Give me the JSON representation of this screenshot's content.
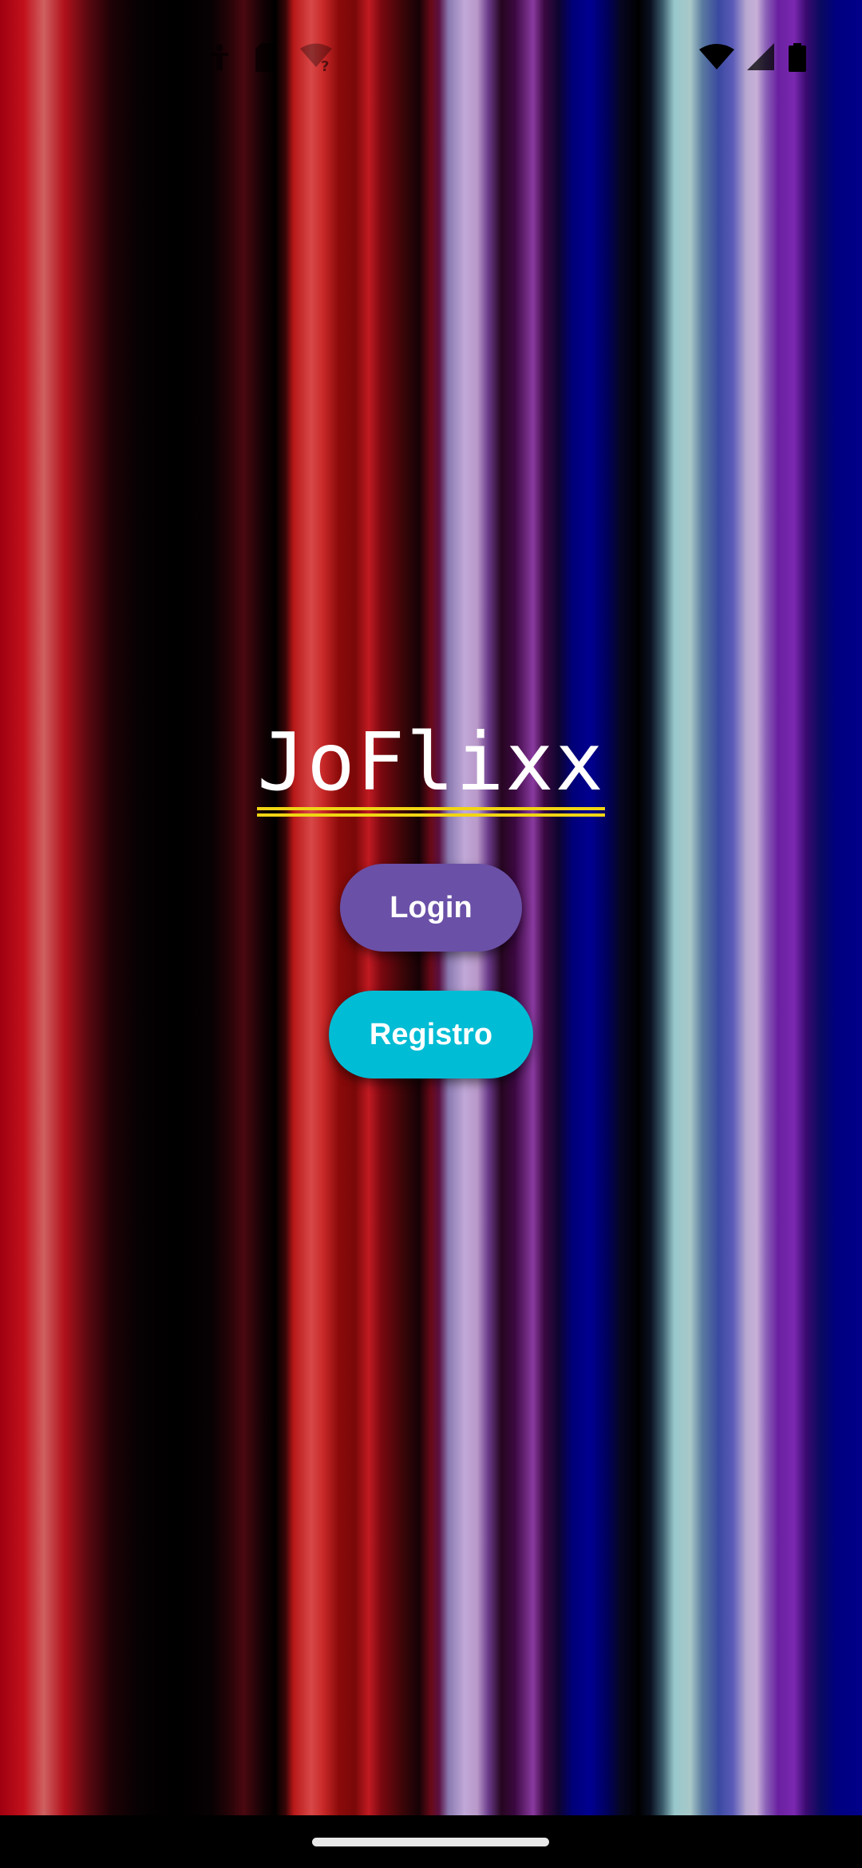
{
  "status_bar": {
    "left_icons": [
      "accessibility-icon",
      "sim-card-icon",
      "wifi-unknown-icon"
    ],
    "right_icons": [
      "wifi-icon",
      "cellular-signal-icon",
      "battery-icon"
    ]
  },
  "app": {
    "title": "JoFlixx"
  },
  "buttons": {
    "login_label": "Login",
    "register_label": "Registro"
  },
  "colors": {
    "title_underline": "#f1d514",
    "login_button": "#6a50a7",
    "register_button": "#00bcd4"
  }
}
